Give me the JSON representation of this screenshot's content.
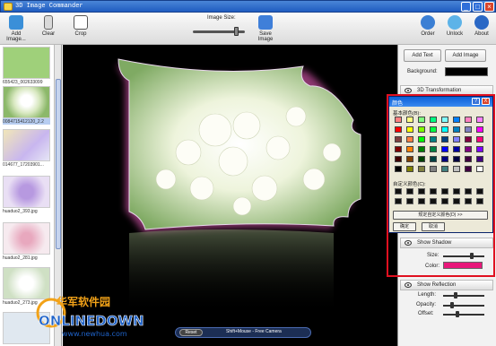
{
  "window": {
    "title": "3D Image Commander",
    "min": "_",
    "max": "□",
    "close": "×"
  },
  "toolbar": {
    "add_images": "Add Image...",
    "clear": "Clear",
    "crop": "Crop",
    "image_size": "Image Size:",
    "save_image": "Save Image",
    "order": "Order",
    "unlock": "Unlock",
    "about": "About",
    "image_size_value": 0.85
  },
  "thumbnails": [
    {
      "caption": "655423_002633099",
      "color": "#9fd07a"
    },
    {
      "caption": "0084715412120_2.2",
      "color": "#e8f0d8"
    },
    {
      "caption": "014677_17203901...",
      "color": "#d6c7ef"
    },
    {
      "caption": "huaduo2_393.jpg",
      "color": "#e9dff4"
    },
    {
      "caption": "huaduo2_281.jpg",
      "color": "#f1dfe6"
    },
    {
      "caption": "huaduo2_273.jpg",
      "color": "#dce8f1"
    },
    {
      "caption": "",
      "color": "#e0e8f0"
    }
  ],
  "canvas": {
    "reset": "Reset",
    "hint": "Shift+Mouse - Free Camera"
  },
  "right": {
    "add_text": "Add Text",
    "add_image": "Add Image",
    "background_label": "Background:",
    "background_color": "#000000",
    "transformation": "3D Transformation",
    "show_shadow": "Show Shadow",
    "size_label": "Size:",
    "color_label": "Color:",
    "shadow_color": "#e8177a",
    "show_reflection": "Show Reflection",
    "length_label": "Length:",
    "opacity_label": "Opacity:",
    "offset_label": "Offset:"
  },
  "dialog": {
    "title": "颜色",
    "help": "?",
    "close": "X",
    "basic_colors_label": "基本颜色(B):",
    "custom_colors_label": "自定义颜色(C):",
    "define_custom": "规定自定义颜色(D) >>",
    "ok": "确定",
    "cancel": "取消",
    "basic_colors": [
      "#ff8080",
      "#ffff80",
      "#80ff80",
      "#00ff80",
      "#80ffff",
      "#0080ff",
      "#ff80c0",
      "#ff80ff",
      "#ff0000",
      "#ffff00",
      "#80ff00",
      "#00ff40",
      "#00ffff",
      "#0080c0",
      "#8080c0",
      "#ff00ff",
      "#804040",
      "#ff8040",
      "#00ff00",
      "#008080",
      "#004080",
      "#8080ff",
      "#800040",
      "#ff0080",
      "#800000",
      "#ff8000",
      "#008000",
      "#008040",
      "#0000ff",
      "#0000a0",
      "#800080",
      "#8000ff",
      "#400000",
      "#804000",
      "#004000",
      "#004040",
      "#000080",
      "#000040",
      "#400040",
      "#400080",
      "#000000",
      "#808000",
      "#808040",
      "#808080",
      "#408080",
      "#c0c0c0",
      "#400040",
      "#ffffff"
    ]
  },
  "watermark": {
    "cn": "华军软件园",
    "en": "ONLINEDOWN",
    "url": "www.newhua.com"
  }
}
